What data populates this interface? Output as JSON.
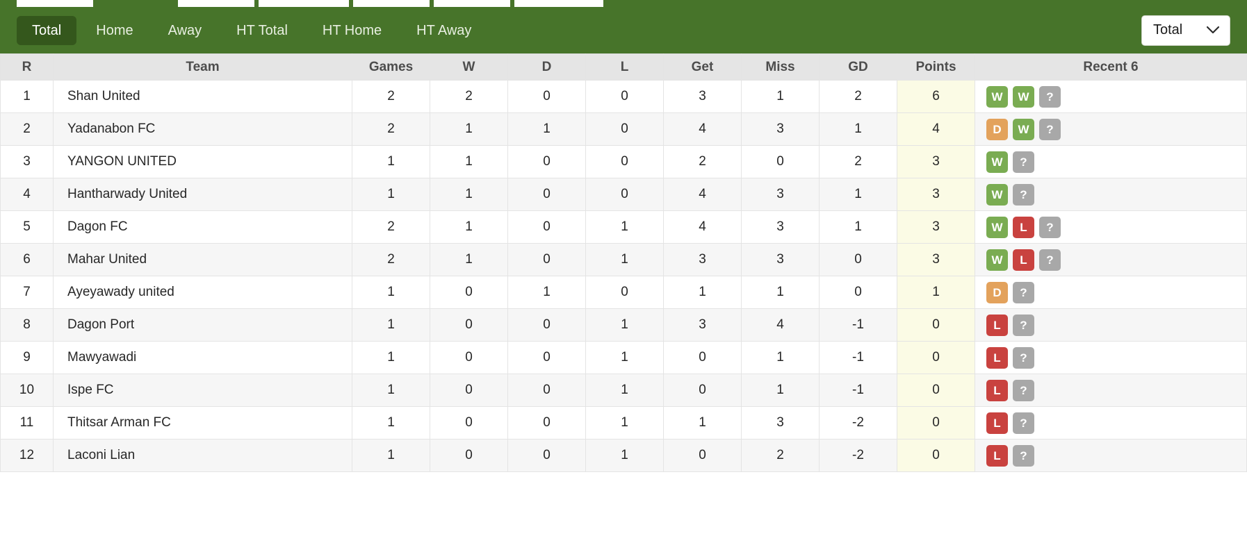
{
  "toolbar": {
    "tabs": [
      {
        "label": "Total",
        "active": true
      },
      {
        "label": "Home",
        "active": false
      },
      {
        "label": "Away",
        "active": false
      },
      {
        "label": "HT Total",
        "active": false
      },
      {
        "label": "HT Home",
        "active": false
      },
      {
        "label": "HT Away",
        "active": false
      }
    ],
    "filter_select": {
      "value": "Total",
      "icon": "chevron-down-icon"
    },
    "accent_color": "#47742a",
    "active_tab_color": "#34571c"
  },
  "table": {
    "columns": [
      "R",
      "Team",
      "Games",
      "W",
      "D",
      "L",
      "Get",
      "Miss",
      "GD",
      "Points",
      "Recent 6"
    ],
    "rows": [
      {
        "rank": "1",
        "team": "Shan United",
        "games": "2",
        "w": "2",
        "d": "0",
        "l": "0",
        "get": "3",
        "miss": "1",
        "gd": "2",
        "points": "6",
        "recent": [
          "W",
          "W",
          "?"
        ]
      },
      {
        "rank": "2",
        "team": "Yadanabon FC",
        "games": "2",
        "w": "1",
        "d": "1",
        "l": "0",
        "get": "4",
        "miss": "3",
        "gd": "1",
        "points": "4",
        "recent": [
          "D",
          "W",
          "?"
        ]
      },
      {
        "rank": "3",
        "team": "YANGON UNITED",
        "games": "1",
        "w": "1",
        "d": "0",
        "l": "0",
        "get": "2",
        "miss": "0",
        "gd": "2",
        "points": "3",
        "recent": [
          "W",
          "?"
        ]
      },
      {
        "rank": "4",
        "team": "Hantharwady United",
        "games": "1",
        "w": "1",
        "d": "0",
        "l": "0",
        "get": "4",
        "miss": "3",
        "gd": "1",
        "points": "3",
        "recent": [
          "W",
          "?"
        ]
      },
      {
        "rank": "5",
        "team": "Dagon FC",
        "games": "2",
        "w": "1",
        "d": "0",
        "l": "1",
        "get": "4",
        "miss": "3",
        "gd": "1",
        "points": "3",
        "recent": [
          "W",
          "L",
          "?"
        ]
      },
      {
        "rank": "6",
        "team": "Mahar United",
        "games": "2",
        "w": "1",
        "d": "0",
        "l": "1",
        "get": "3",
        "miss": "3",
        "gd": "0",
        "points": "3",
        "recent": [
          "W",
          "L",
          "?"
        ]
      },
      {
        "rank": "7",
        "team": "Ayeyawady united",
        "games": "1",
        "w": "0",
        "d": "1",
        "l": "0",
        "get": "1",
        "miss": "1",
        "gd": "0",
        "points": "1",
        "recent": [
          "D",
          "?"
        ]
      },
      {
        "rank": "8",
        "team": "Dagon Port",
        "games": "1",
        "w": "0",
        "d": "0",
        "l": "1",
        "get": "3",
        "miss": "4",
        "gd": "-1",
        "points": "0",
        "recent": [
          "L",
          "?"
        ]
      },
      {
        "rank": "9",
        "team": "Mawyawadi",
        "games": "1",
        "w": "0",
        "d": "0",
        "l": "1",
        "get": "0",
        "miss": "1",
        "gd": "-1",
        "points": "0",
        "recent": [
          "L",
          "?"
        ]
      },
      {
        "rank": "10",
        "team": "Ispe FC",
        "games": "1",
        "w": "0",
        "d": "0",
        "l": "1",
        "get": "0",
        "miss": "1",
        "gd": "-1",
        "points": "0",
        "recent": [
          "L",
          "?"
        ]
      },
      {
        "rank": "11",
        "team": "Thitsar Arman FC",
        "games": "1",
        "w": "0",
        "d": "0",
        "l": "1",
        "get": "1",
        "miss": "3",
        "gd": "-2",
        "points": "0",
        "recent": [
          "L",
          "?"
        ]
      },
      {
        "rank": "12",
        "team": "Laconi Lian",
        "games": "1",
        "w": "0",
        "d": "0",
        "l": "1",
        "get": "0",
        "miss": "2",
        "gd": "-2",
        "points": "0",
        "recent": [
          "L",
          "?"
        ]
      }
    ]
  },
  "legend": {
    "win_color": "#7aac52",
    "draw_color": "#e3a25c",
    "loss_color": "#c9423f",
    "unknown_color": "#a8a8a8",
    "team_link_color": "#5ba32b",
    "points_cell_color": "#fbfbe5"
  }
}
